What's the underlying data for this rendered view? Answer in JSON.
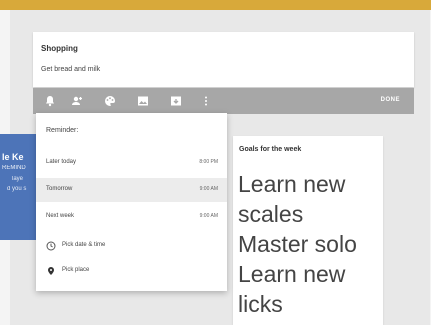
{
  "left_card": {
    "title": "le Ke",
    "line1": "REMIND",
    "line2": "laye",
    "line3": "d you s"
  },
  "note": {
    "title": "Shopping",
    "body": "Get bread and milk"
  },
  "toolbar": {
    "icons": [
      "reminder-icon",
      "collaborator-icon",
      "color-palette-icon",
      "image-icon",
      "archive-icon",
      "more-icon"
    ],
    "done_label": "DONE"
  },
  "reminder_menu": {
    "header": "Reminder:",
    "options": [
      {
        "label": "Later today",
        "time": "8:00 PM"
      },
      {
        "label": "Tomorrow",
        "time": "9:00 AM"
      },
      {
        "label": "Next week",
        "time": "9:00 AM"
      }
    ],
    "pick_date_label": "Pick date & time",
    "pick_place_label": "Pick place"
  },
  "goals": {
    "title": "Goals for the week",
    "body": "Learn new scales Master solo Learn new licks"
  },
  "colors": {
    "top_bar": "#d8a93a",
    "left_card": "#4d74b8",
    "toolbar": "#a7a7a7"
  }
}
